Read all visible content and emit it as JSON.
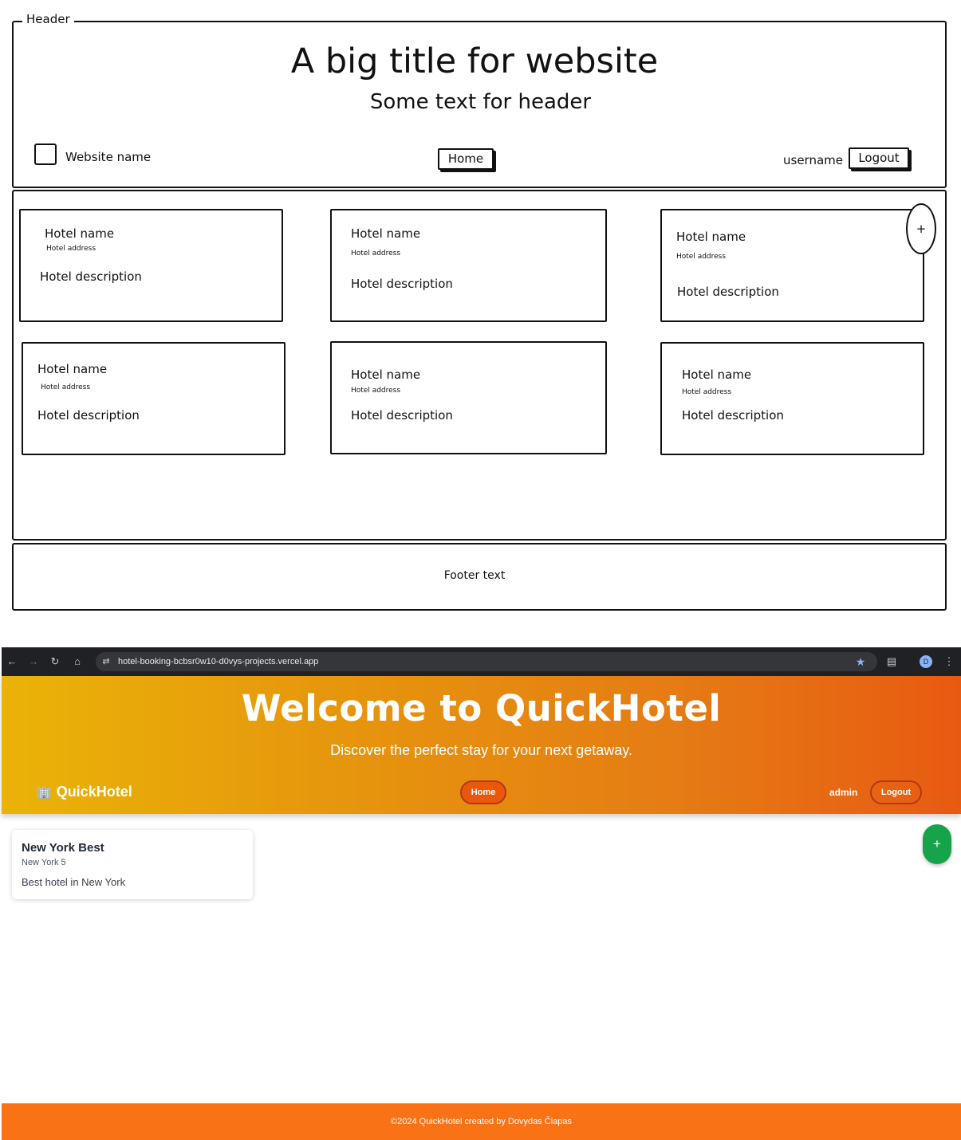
{
  "wireframe": {
    "header_legend": "Header",
    "title": "A big title for website",
    "subtitle": "Some text for header",
    "website_name": "Website name",
    "home_button": "Home",
    "username": "username",
    "logout_button": "Logout",
    "add_button": "+",
    "cards": [
      {
        "name": "Hotel name",
        "address": "Hotel address",
        "description": "Hotel description"
      },
      {
        "name": "Hotel name",
        "address": "Hotel address",
        "description": "Hotel description"
      },
      {
        "name": "Hotel name",
        "address": "Hotel address",
        "description": "Hotel description"
      },
      {
        "name": "Hotel name",
        "address": "Hotel address",
        "description": "Hotel description"
      },
      {
        "name": "Hotel name",
        "address": "Hotel address",
        "description": "Hotel description"
      },
      {
        "name": "Hotel name",
        "address": "Hotel address",
        "description": "Hotel description"
      }
    ],
    "footer_text": "Footer text"
  },
  "browser": {
    "url": "hotel-booking-bcbsr0w10-d0vys-projects.vercel.app",
    "profile_initial": "D",
    "icons": [
      "back-icon",
      "forward-icon",
      "reload-icon",
      "home-icon",
      "site-settings-icon",
      "star-icon",
      "extensions-icon",
      "profile-icon",
      "menu-icon"
    ]
  },
  "site": {
    "hero_title": "Welcome to QuickHotel",
    "hero_subtitle": "Discover the perfect stay for your next getaway.",
    "brand_icon": "🏢",
    "brand_name": "QuickHotel",
    "home_button": "Home",
    "username": "admin",
    "logout_button": "Logout",
    "add_button": "+",
    "hotels": [
      {
        "name": "New York Best",
        "address": "New York 5",
        "description": "Best hotel in New York"
      }
    ],
    "footer_text": "©2024 QuickHotel created by Dovydas Čiapas",
    "colors": {
      "gradient_start": "#eab308",
      "gradient_end": "#e85a12",
      "home_button": "#ea580c",
      "fab": "#16a34a",
      "footer": "#f97316"
    }
  }
}
